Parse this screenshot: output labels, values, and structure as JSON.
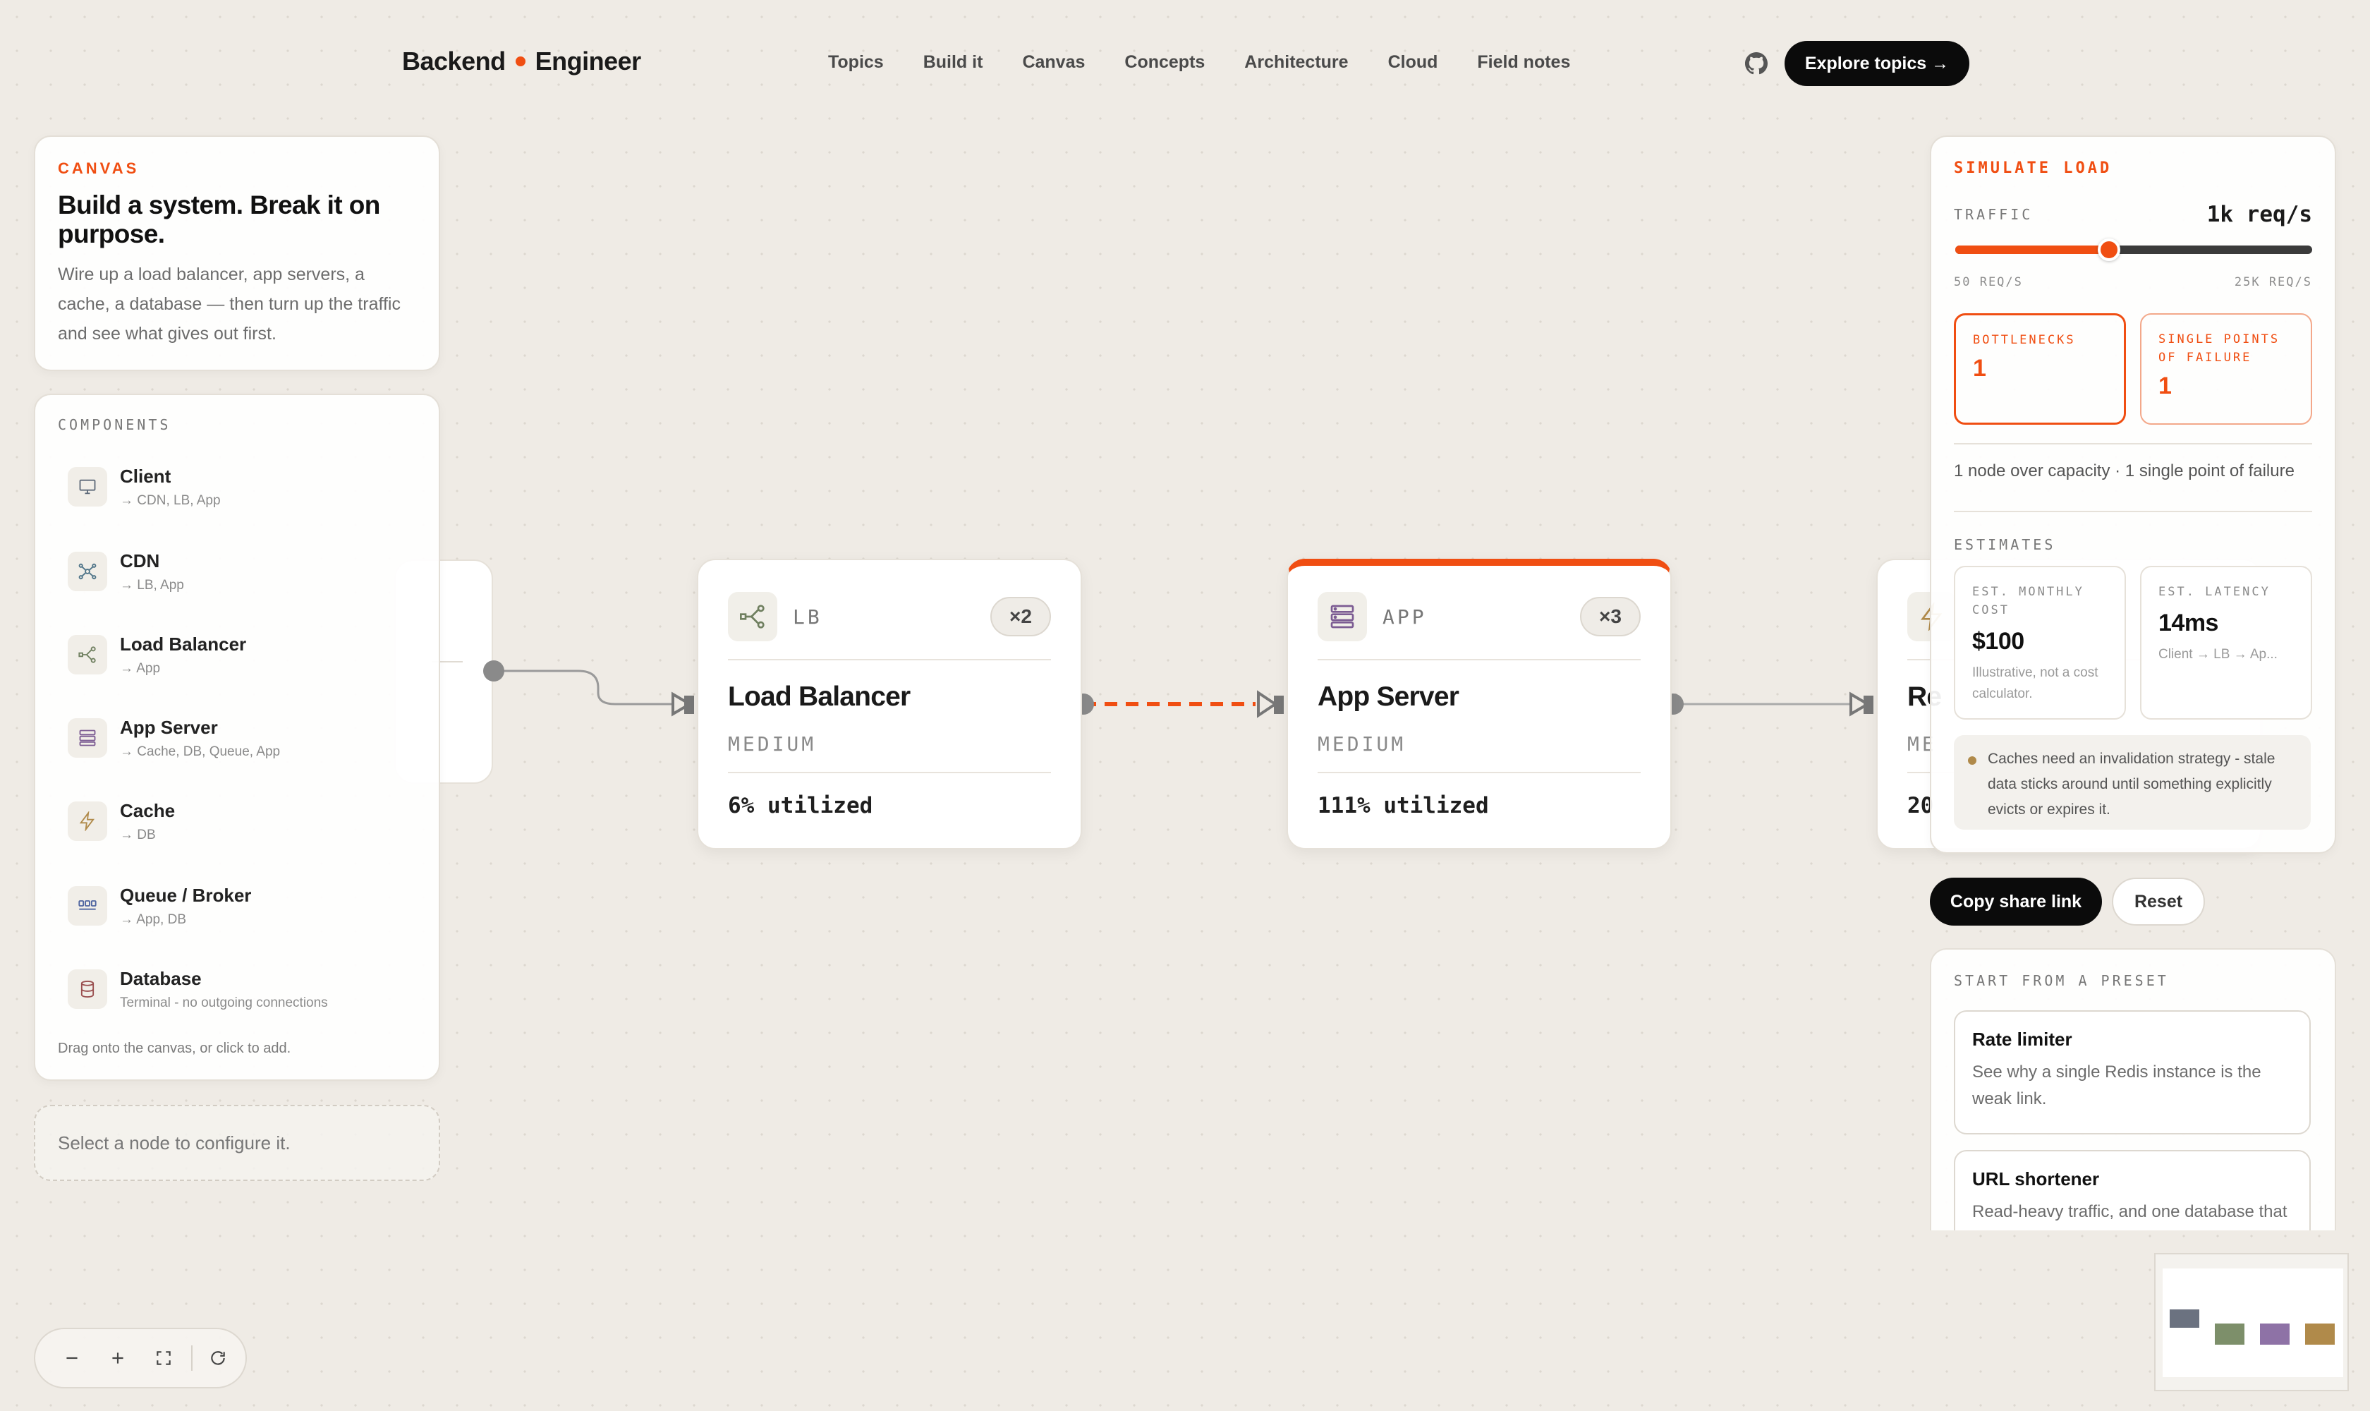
{
  "nav": {
    "brand_left": "Backend",
    "brand_right": "Engineer",
    "links": [
      "Topics",
      "Build it",
      "Canvas",
      "Concepts",
      "Architecture",
      "Cloud",
      "Field notes"
    ],
    "cta": "Explore topics →",
    "icons": [
      "github-icon"
    ]
  },
  "colors": {
    "accent": "#f04e12",
    "dark": "#0b0b0b",
    "background": "#efebe5"
  },
  "intro": {
    "eyebrow": "CANVAS",
    "title": "Build a system. Break it on purpose.",
    "body": "Wire up a load balancer, app servers, a cache, a database — then turn up the traffic and see what gives out first."
  },
  "components": {
    "label": "COMPONENTS",
    "items": [
      {
        "name": "Client",
        "sub": "→ CDN, LB, App",
        "icon": "monitor-icon"
      },
      {
        "name": "CDN",
        "sub": "→ LB, App",
        "icon": "network-icon"
      },
      {
        "name": "Load Balancer",
        "sub": "→ App",
        "icon": "split-icon"
      },
      {
        "name": "App Server",
        "sub": "→ Cache, DB, Queue, App",
        "icon": "server-icon"
      },
      {
        "name": "Cache",
        "sub": "→ DB",
        "icon": "bolt-icon"
      },
      {
        "name": "Queue / Broker",
        "sub": "→ App, DB",
        "icon": "queue-icon"
      },
      {
        "name": "Database",
        "sub": "Terminal - no outgoing connections",
        "icon": "database-icon"
      }
    ],
    "hint": "Drag onto the canvas, or click to add."
  },
  "select_hint": "Select a node to configure it.",
  "nodes": [
    {
      "kind": "LB",
      "count": "×2",
      "title": "Load Balancer",
      "tier": "MEDIUM",
      "util": "6% utilized",
      "icon": "split-icon"
    },
    {
      "kind": "APP",
      "count": "×3",
      "title": "App Server",
      "tier": "MEDIUM",
      "util": "111% utilized",
      "icon": "server-icon"
    },
    {
      "title": "Re",
      "tier": "ME",
      "util": "20",
      "icon": "bolt-icon"
    }
  ],
  "simulate": {
    "label": "SIMULATE LOAD",
    "traffic_label": "TRAFFIC",
    "traffic_value": "1k req/s",
    "slider_fraction": 0.43,
    "min_label": "50 REQ/S",
    "max_label": "25K REQ/S",
    "bottlenecks_label": "BOTTLENECKS",
    "bottlenecks_value": "1",
    "spof_label": "SINGLE POINTS OF FAILURE",
    "spof_value": "1",
    "status": "1 node over capacity · 1 single point of failure",
    "estimates_label": "ESTIMATES",
    "cost_label": "EST. MONTHLY COST",
    "cost_value": "$100",
    "cost_note": "Illustrative, not a cost calculator.",
    "latency_label": "EST. LATENCY",
    "latency_value": "14ms",
    "latency_note": "Client → LB → Ap...",
    "tip": "Caches need an invalidation strategy - stale data sticks around until something explicitly evicts or expires it."
  },
  "actions": {
    "share": "Copy share link",
    "reset": "Reset"
  },
  "presets": {
    "label": "START FROM A PRESET",
    "items": [
      {
        "name": "Rate limiter",
        "desc": "See why a single Redis instance is the weak link."
      },
      {
        "name": "URL shortener",
        "desc": "Read-heavy traffic, and one database that"
      }
    ]
  }
}
